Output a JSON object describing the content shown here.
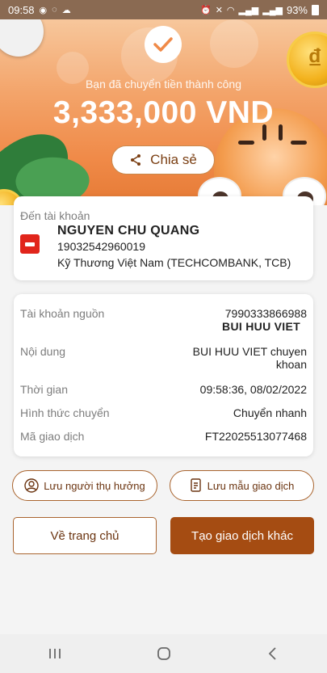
{
  "status_bar": {
    "time": "09:58",
    "battery": "93%"
  },
  "hero": {
    "success_message": "Bạn đã chuyển tiền thành công",
    "amount": "3,333,000 VND",
    "share_label": "Chia sẻ",
    "coin_glyph": "₫"
  },
  "recipient": {
    "label": "Đến tài khoản",
    "name": "NGUYEN CHU QUANG",
    "account_number": "19032542960019",
    "bank": "Kỹ Thương Việt Nam (TECHCOMBANK, TCB)"
  },
  "details": {
    "source_label": "Tài khoản nguồn",
    "source_account": "7990333866988",
    "source_name": "BUI HUU VIET",
    "content_label": "Nội dung",
    "content_value_line1": "BUI HUU VIET chuyen",
    "content_value_line2": "khoan",
    "time_label": "Thời gian",
    "time_value": "09:58:36, 08/02/2022",
    "method_label": "Hình thức chuyển",
    "method_value": "Chuyển nhanh",
    "txn_label": "Mã giao dịch",
    "txn_value": "FT22025513077468"
  },
  "actions": {
    "save_beneficiary": "Lưu người thụ hưởng",
    "save_template": "Lưu mẫu giao dịch",
    "home": "Về trang chủ",
    "new_transaction": "Tạo giao dịch khác"
  },
  "colors": {
    "accent": "#a54c12",
    "hero_orange": "#f08a48"
  },
  "icons": [
    "check-icon",
    "share-icon",
    "user-circle-icon",
    "document-icon",
    "recents-icon",
    "home-icon",
    "back-icon"
  ]
}
